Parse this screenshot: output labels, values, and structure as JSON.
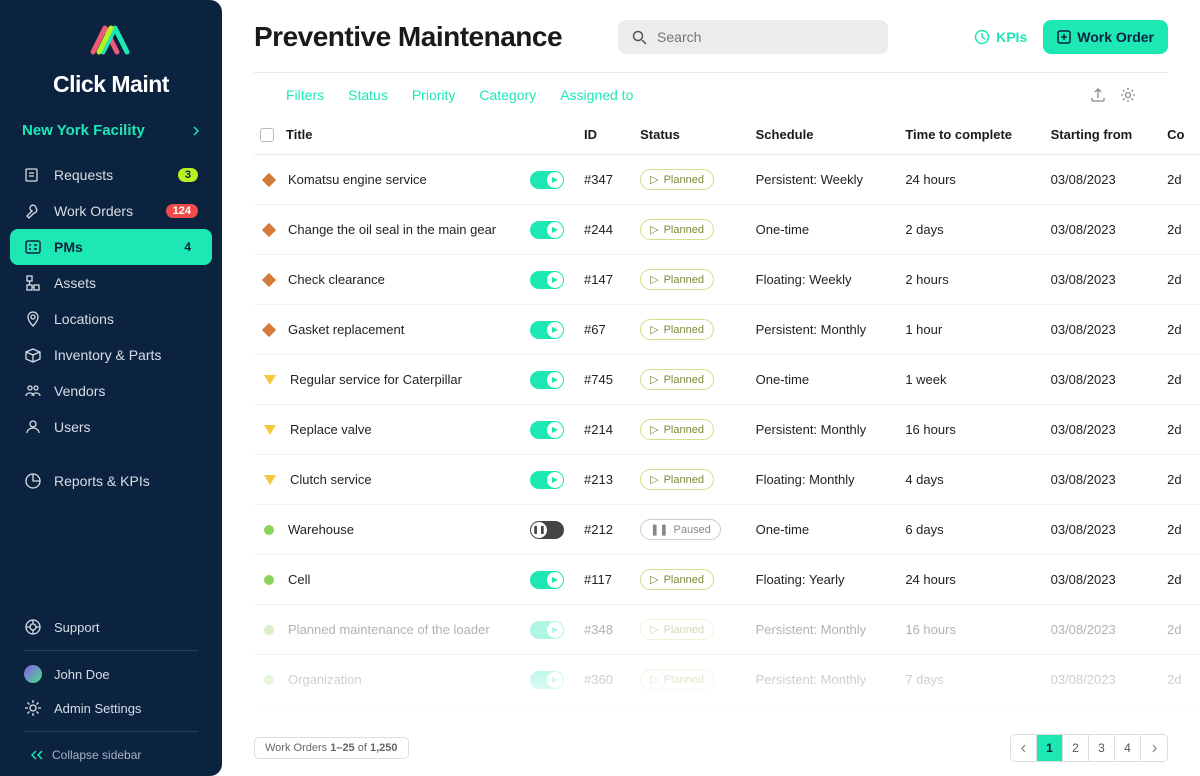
{
  "brand": "Click Maint",
  "facility": "New York Facility",
  "nav": {
    "requests": {
      "label": "Requests",
      "badge": "3"
    },
    "work_orders": {
      "label": "Work Orders",
      "badge": "124"
    },
    "pms": {
      "label": "PMs",
      "badge": "4"
    },
    "assets": {
      "label": "Assets"
    },
    "locations": {
      "label": "Locations"
    },
    "inventory": {
      "label": "Inventory & Parts"
    },
    "vendors": {
      "label": "Vendors"
    },
    "users": {
      "label": "Users"
    },
    "reports": {
      "label": "Reports & KPIs"
    },
    "support": {
      "label": "Support"
    },
    "user": {
      "label": "John Doe"
    },
    "admin": {
      "label": "Admin Settings"
    },
    "collapse": {
      "label": "Collapse sidebar"
    }
  },
  "header": {
    "title": "Preventive Maintenance",
    "search_placeholder": "Search",
    "kpis": "KPIs",
    "work_order_btn": "Work Order"
  },
  "filters": {
    "f0": "Filters",
    "f1": "Status",
    "f2": "Priority",
    "f3": "Category",
    "f4": "Assigned to"
  },
  "columns": {
    "title": "Title",
    "id": "ID",
    "status": "Status",
    "schedule": "Schedule",
    "time": "Time to complete",
    "starting": "Starting from",
    "co": "Co"
  },
  "rows": [
    {
      "pri": "high",
      "title": "Komatsu engine service",
      "on": true,
      "id": "#347",
      "status": "Planned",
      "schedule": "Persistent: Weekly",
      "time": "24 hours",
      "date": "03/08/2023",
      "co": "2d"
    },
    {
      "pri": "high",
      "title": "Change the oil seal in the main gear",
      "on": true,
      "id": "#244",
      "status": "Planned",
      "schedule": "One-time",
      "time": "2 days",
      "date": "03/08/2023",
      "co": "2d"
    },
    {
      "pri": "high",
      "title": "Check clearance",
      "on": true,
      "id": "#147",
      "status": "Planned",
      "schedule": "Floating: Weekly",
      "time": "2 hours",
      "date": "03/08/2023",
      "co": "2d"
    },
    {
      "pri": "high",
      "title": "Gasket replacement",
      "on": true,
      "id": "#67",
      "status": "Planned",
      "schedule": "Persistent: Monthly",
      "time": "1 hour",
      "date": "03/08/2023",
      "co": "2d"
    },
    {
      "pri": "med",
      "title": "Regular service for Caterpillar",
      "on": true,
      "id": "#745",
      "status": "Planned",
      "schedule": "One-time",
      "time": "1 week",
      "date": "03/08/2023",
      "co": "2d"
    },
    {
      "pri": "med",
      "title": "Replace valve",
      "on": true,
      "id": "#214",
      "status": "Planned",
      "schedule": "Persistent: Monthly",
      "time": "16 hours",
      "date": "03/08/2023",
      "co": "2d"
    },
    {
      "pri": "med",
      "title": "Clutch service",
      "on": true,
      "id": "#213",
      "status": "Planned",
      "schedule": "Floating: Monthly",
      "time": "4 days",
      "date": "03/08/2023",
      "co": "2d"
    },
    {
      "pri": "low",
      "title": "Warehouse",
      "on": false,
      "id": "#212",
      "status": "Paused",
      "schedule": "One-time",
      "time": "6 days",
      "date": "03/08/2023",
      "co": "2d"
    },
    {
      "pri": "low",
      "title": "Cell",
      "on": true,
      "id": "#117",
      "status": "Planned",
      "schedule": "Floating: Yearly",
      "time": "24 hours",
      "date": "03/08/2023",
      "co": "2d"
    },
    {
      "pri": "low",
      "title": "Planned maintenance of the loader",
      "on": true,
      "id": "#348",
      "status": "Planned",
      "schedule": "Persistent: Monthly",
      "time": "16 hours",
      "date": "03/08/2023",
      "co": "2d",
      "faded": true
    },
    {
      "pri": "low",
      "title": "Organization",
      "on": true,
      "id": "#360",
      "status": "Planned",
      "schedule": "Persistent: Monthly",
      "time": "7 days",
      "date": "03/08/2023",
      "co": "2d",
      "faded": true
    }
  ],
  "footer": {
    "count_prefix": "Work Orders ",
    "count_range": "1–25",
    "count_of": " of ",
    "count_total": "1,250",
    "pages": [
      "1",
      "2",
      "3",
      "4"
    ]
  }
}
